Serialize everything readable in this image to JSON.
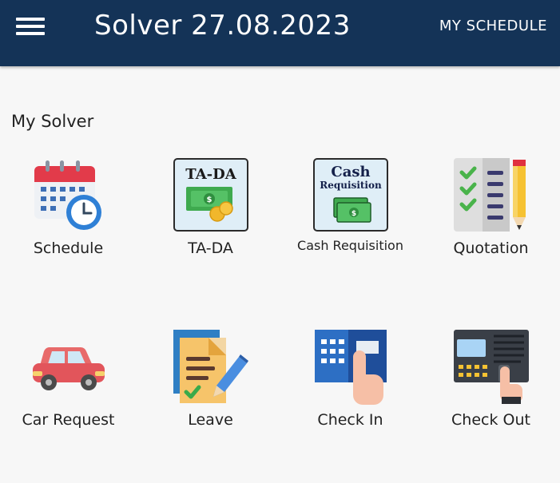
{
  "header": {
    "title": "Solver 27.08.2023",
    "schedule_button": "MY SCHEDULE",
    "menu_icon": "hamburger-menu-icon",
    "background": "#143357"
  },
  "section": {
    "title": "My Solver"
  },
  "tiles": [
    {
      "label": "Schedule",
      "icon": "calendar-clock-icon"
    },
    {
      "label": "TA-DA",
      "icon": "ta-da-money-icon",
      "icon_text": "TA-DA"
    },
    {
      "label": "Cash Requisition",
      "icon": "cash-requisition-icon",
      "icon_text_1": "Cash",
      "icon_text_2": "Requisition"
    },
    {
      "label": "Quotation",
      "icon": "checklist-pencil-icon"
    },
    {
      "label": "Car Request",
      "icon": "car-icon"
    },
    {
      "label": "Leave",
      "icon": "document-pen-icon"
    },
    {
      "label": "Check In",
      "icon": "keypad-finger-icon"
    },
    {
      "label": "Check Out",
      "icon": "fingerprint-terminal-icon"
    }
  ]
}
